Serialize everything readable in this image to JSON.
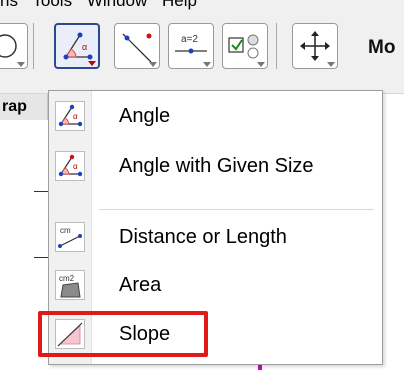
{
  "menubar": {
    "items": [
      "ns",
      "Tools",
      "Window",
      "Help"
    ]
  },
  "toolbar": {
    "mode_label": "Mo",
    "active_tool": "angle"
  },
  "panel": {
    "header_label": "rap"
  },
  "dropdown": {
    "items": [
      {
        "label": "Angle",
        "icon": "angle-icon"
      },
      {
        "label": "Angle with Given Size",
        "icon": "angle-given-size-icon"
      },
      {
        "label": "Distance or Length",
        "icon": "distance-length-icon",
        "icon_text": "cm"
      },
      {
        "label": "Area",
        "icon": "area-icon",
        "icon_text": "cm2"
      },
      {
        "label": "Slope",
        "icon": "slope-icon",
        "highlighted": true
      }
    ]
  },
  "colors": {
    "highlight": "#e01919",
    "active_border": "#2d4a8a",
    "point_blue": "#1f3fbf",
    "point_red": "#d01010"
  }
}
